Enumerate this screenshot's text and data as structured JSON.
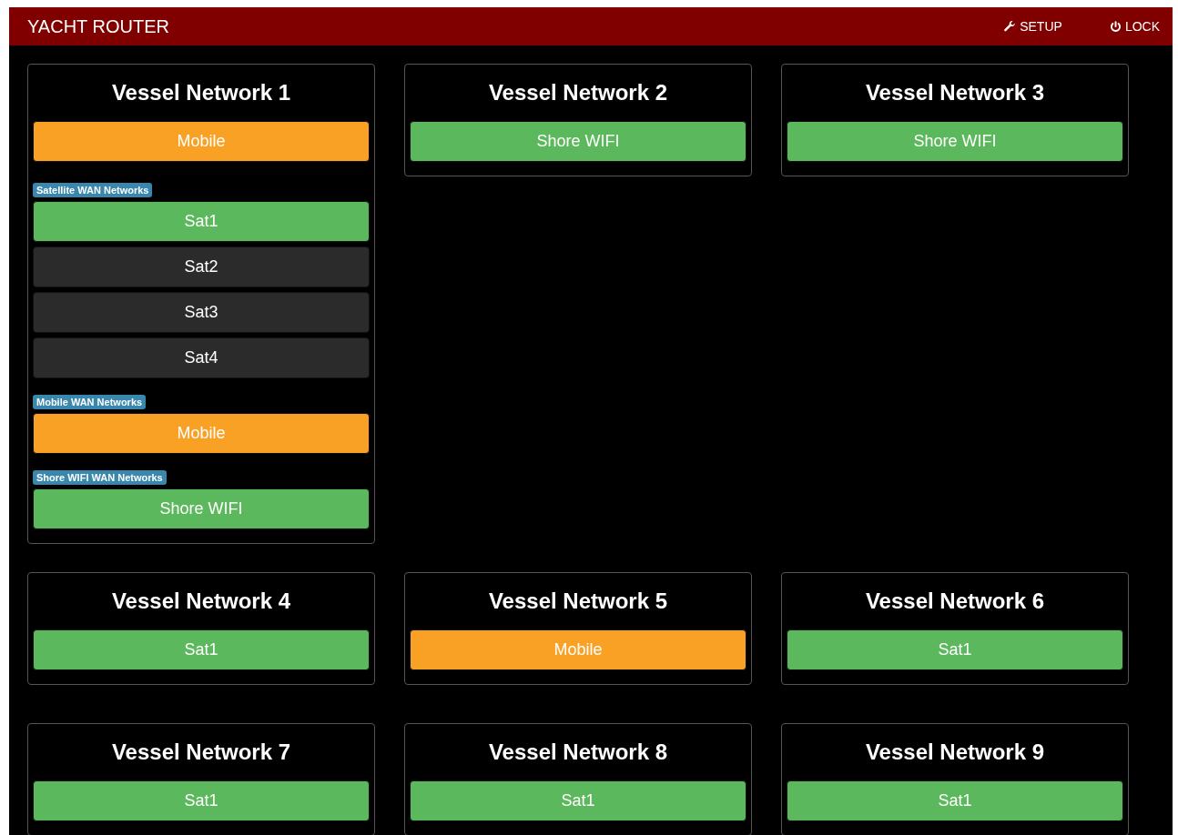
{
  "header": {
    "title": "YACHT ROUTER",
    "actions": [
      {
        "kind": "setup",
        "label": "SETUP"
      },
      {
        "kind": "lock",
        "label": "LOCK"
      }
    ]
  },
  "networks": [
    {
      "title": "Vessel Network 1",
      "current": {
        "label": "Mobile",
        "color": "#f9a124"
      },
      "groups": [
        {
          "label": "Satellite WAN Networks",
          "options": [
            {
              "label": "Sat1",
              "color": "#5cb85c"
            },
            {
              "label": "Sat2",
              "color": "#2b2b2b"
            },
            {
              "label": "Sat3",
              "color": "#2b2b2b"
            },
            {
              "label": "Sat4",
              "color": "#2b2b2b"
            }
          ]
        },
        {
          "label": "Mobile WAN Networks",
          "options": [
            {
              "label": "Mobile",
              "color": "#f9a124"
            }
          ]
        },
        {
          "label": "Shore WIFI WAN Networks",
          "options": [
            {
              "label": "Shore WIFI",
              "color": "#5cb85c"
            }
          ]
        }
      ]
    },
    {
      "title": "Vessel Network 2",
      "current": {
        "label": "Shore WIFI",
        "color": "#5cb85c"
      }
    },
    {
      "title": "Vessel Network 3",
      "current": {
        "label": "Shore WIFI",
        "color": "#5cb85c"
      }
    },
    {
      "title": "Vessel Network 4",
      "current": {
        "label": "Sat1",
        "color": "#5cb85c"
      }
    },
    {
      "title": "Vessel Network 5",
      "current": {
        "label": "Mobile",
        "color": "#f9a124"
      }
    },
    {
      "title": "Vessel Network 6",
      "current": {
        "label": "Sat1",
        "color": "#5cb85c"
      }
    },
    {
      "title": "Vessel Network 7",
      "current": {
        "label": "Sat1",
        "color": "#5cb85c"
      }
    },
    {
      "title": "Vessel Network 8",
      "current": {
        "label": "Sat1",
        "color": "#5cb85c"
      }
    },
    {
      "title": "Vessel Network 9",
      "current": {
        "label": "Sat1",
        "color": "#5cb85c"
      }
    }
  ]
}
